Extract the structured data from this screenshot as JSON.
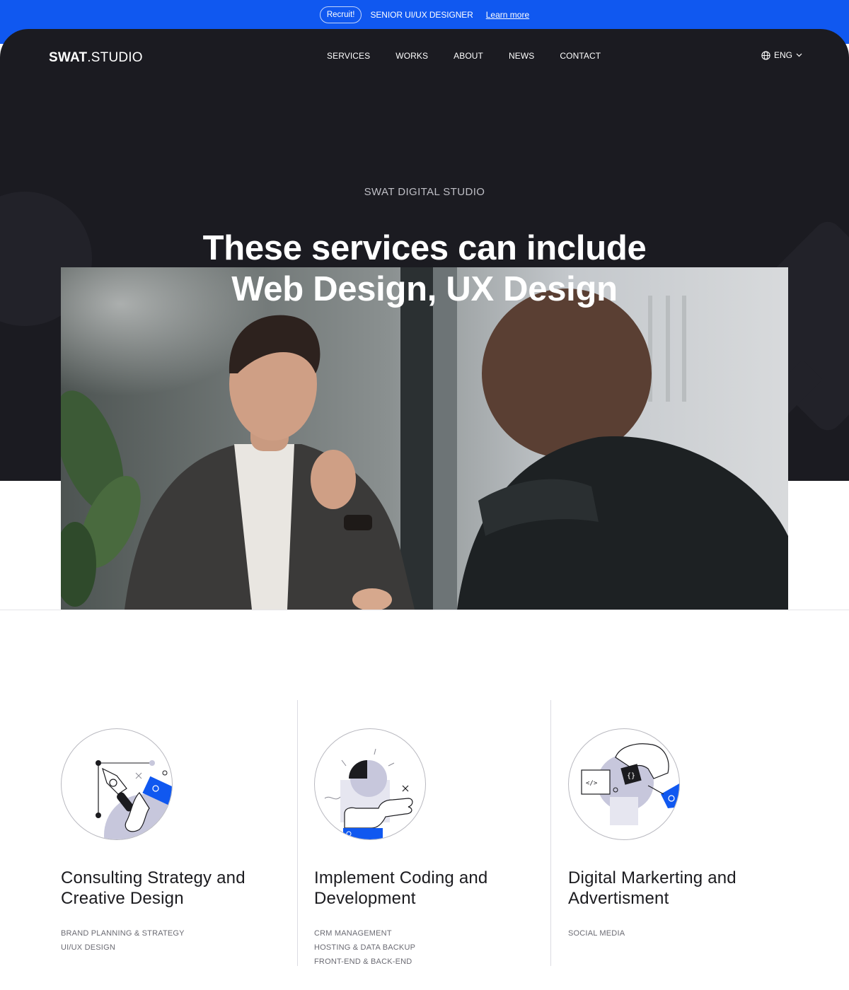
{
  "announcement": {
    "pill": "Recruit!",
    "text": "SENIOR UI/UX DESIGNER",
    "link": "Learn more"
  },
  "nav": {
    "logo_bold": "SWAT",
    "logo_light": ".STUDIO",
    "items": [
      "SERVICES",
      "WORKS",
      "ABOUT",
      "NEWS",
      "CONTACT"
    ],
    "language": "ENG"
  },
  "hero": {
    "eyebrow": "SWAT DIGITAL STUDIO",
    "headline_line1": "These services can include",
    "headline_line2": "Web Design, UX Design"
  },
  "services": [
    {
      "title_line1": "Consulting Strategy and",
      "title_line2": "Creative Design",
      "items": [
        "BRAND PLANNING & STRATEGY",
        "UI/UX DESIGN"
      ]
    },
    {
      "title_line1": "Implement Coding and",
      "title_line2": "Development",
      "items": [
        "CRM MANAGEMENT",
        "HOSTING & DATA BACKUP",
        "FRONT-END & BACK-END"
      ]
    },
    {
      "title_line1": "Digital Markerting and",
      "title_line2": "Advertisment",
      "items": [
        "SOCIAL MEDIA"
      ]
    }
  ],
  "colors": {
    "accent_blue": "#1058f0",
    "hero_dark": "#1b1b21",
    "illustration_lavender": "#c7c7dc"
  }
}
